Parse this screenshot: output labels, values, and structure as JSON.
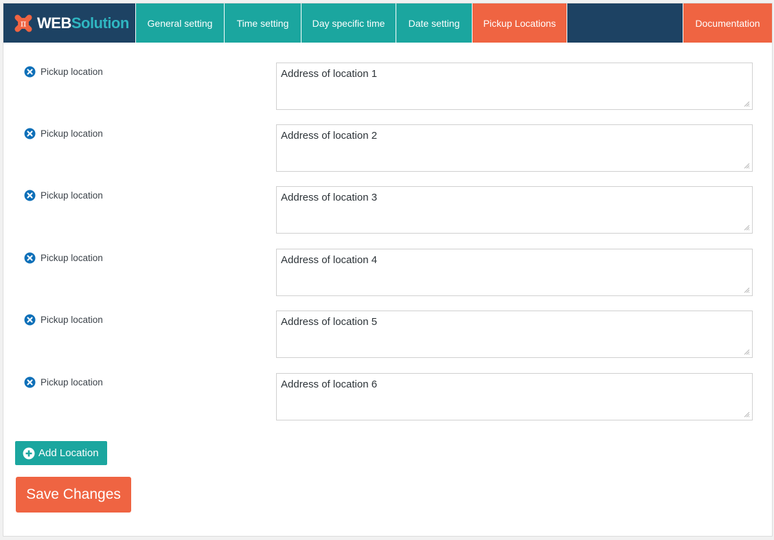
{
  "brand": {
    "logo_web": "WEB",
    "logo_solution": "Solution",
    "accent_teal": "#1ba69f",
    "accent_orange": "#ef6442",
    "nav_bg": "#1d4263"
  },
  "nav": {
    "tabs": [
      {
        "label": "General setting",
        "active": false
      },
      {
        "label": "Time setting",
        "active": false
      },
      {
        "label": "Day specific time",
        "active": false
      },
      {
        "label": "Date setting",
        "active": false
      },
      {
        "label": "Pickup Locations",
        "active": true
      }
    ],
    "documentation_label": "Documentation"
  },
  "locations": [
    {
      "label": "Pickup location",
      "value": "Address of location 1",
      "icon": "remove-circle-icon"
    },
    {
      "label": "Pickup location",
      "value": "Address of location 2",
      "icon": "remove-circle-icon"
    },
    {
      "label": "Pickup location",
      "value": "Address of location 3",
      "icon": "remove-circle-icon"
    },
    {
      "label": "Pickup location",
      "value": "Address of location 4",
      "icon": "remove-circle-icon"
    },
    {
      "label": "Pickup location",
      "value": "Address of location 5",
      "icon": "remove-circle-icon"
    },
    {
      "label": "Pickup location",
      "value": "Address of location 6",
      "icon": "remove-circle-icon"
    }
  ],
  "actions": {
    "add_location_label": "Add Location",
    "add_icon": "plus-circle-icon",
    "save_label": "Save Changes"
  }
}
